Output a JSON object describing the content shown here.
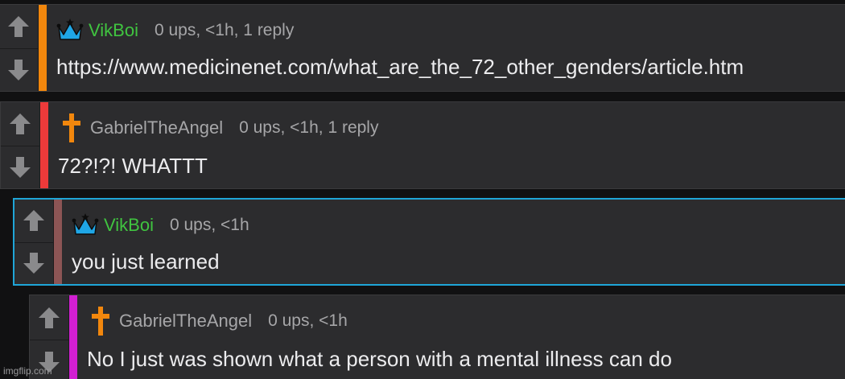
{
  "comments": [
    {
      "username": "VikBoi",
      "stats": "0 ups, <1h, 1 reply",
      "text": "https://www.medicinenet.com/what_are_the_72_other_genders/article.htm",
      "badge": "crown-icon",
      "username_color": "#40c440",
      "stripe_color": "#f2870d"
    },
    {
      "username": "GabrielTheAngel",
      "stats": "0 ups, <1h, 1 reply",
      "text": "72?!?! WHATTT",
      "badge": "cross-icon",
      "username_color": "#a6a6a8",
      "stripe_color": "#ec3a3a"
    },
    {
      "username": "VikBoi",
      "stats": "0 ups, <1h",
      "text": "you just learned",
      "badge": "crown-icon",
      "username_color": "#40c440",
      "stripe_color": "#8c5555"
    },
    {
      "username": "GabrielTheAngel",
      "stats": "0 ups, <1h",
      "text": "No I just was shown what a person with a mental illness can do",
      "badge": "cross-icon",
      "username_color": "#a6a6a8",
      "stripe_color": "#d21fd2"
    }
  ],
  "icons": {
    "upvote": "arrow-up-icon",
    "downvote": "arrow-down-icon"
  },
  "accent_color": "#1fa6d8",
  "watermark": "imgflip.com"
}
